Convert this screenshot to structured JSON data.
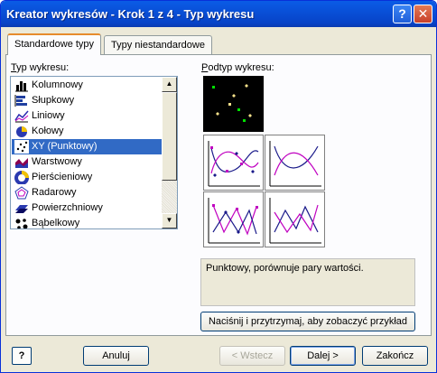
{
  "window": {
    "title": "Kreator wykresów - Krok 1 z 4 - Typ wykresu"
  },
  "tabs": [
    {
      "label": "Standardowe typy",
      "active": true
    },
    {
      "label": "Typy niestandardowe",
      "active": false
    }
  ],
  "chart_type": {
    "label_prefix": "T",
    "label_rest": "yp wykresu:",
    "items": [
      {
        "label": "Kolumnowy",
        "icon": "column-chart-icon"
      },
      {
        "label": "Słupkowy",
        "icon": "bar-chart-icon"
      },
      {
        "label": "Liniowy",
        "icon": "line-chart-icon"
      },
      {
        "label": "Kołowy",
        "icon": "pie-chart-icon"
      },
      {
        "label": "XY (Punktowy)",
        "icon": "scatter-chart-icon",
        "selected": true
      },
      {
        "label": "Warstwowy",
        "icon": "area-chart-icon"
      },
      {
        "label": "Pierścieniowy",
        "icon": "doughnut-chart-icon"
      },
      {
        "label": "Radarowy",
        "icon": "radar-chart-icon"
      },
      {
        "label": "Powierzchniowy",
        "icon": "surface-chart-icon"
      },
      {
        "label": "Bąbelkowy",
        "icon": "bubble-chart-icon"
      }
    ]
  },
  "subtype": {
    "label_prefix": "P",
    "label_rest": "odtyp wykresu:",
    "description": "Punktowy, porównuje pary wartości."
  },
  "buttons": {
    "preview": "Naciśnij i przytrzymaj, aby zobaczyć przykład",
    "help": "?",
    "cancel": "Anuluj",
    "back": "< Wstecz",
    "next": "Dalej >",
    "finish": "Zakończ"
  },
  "colors": {
    "selection": "#316ac5",
    "title_bar": "#0950d8"
  }
}
